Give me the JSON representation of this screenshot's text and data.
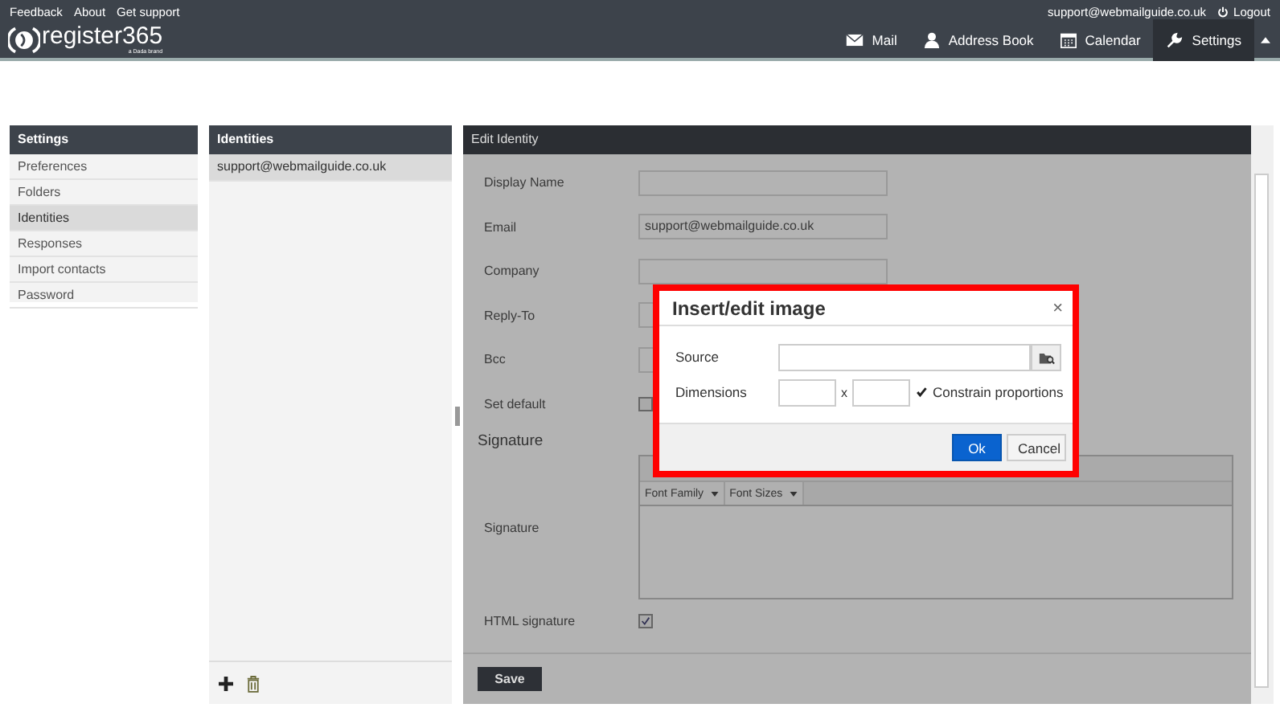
{
  "top_links": [
    "Feedback",
    "About",
    "Get support"
  ],
  "user": {
    "email": "support@webmailguide.co.uk",
    "logout": "Logout"
  },
  "brand": {
    "name": "register365",
    "tagline": "a Dada brand"
  },
  "nav": [
    {
      "label": "Mail",
      "selected": false
    },
    {
      "label": "Address Book",
      "selected": false
    },
    {
      "label": "Calendar",
      "selected": false
    },
    {
      "label": "Settings",
      "selected": true
    }
  ],
  "settings": {
    "title": "Settings",
    "items": [
      {
        "label": "Preferences",
        "selected": false
      },
      {
        "label": "Folders",
        "selected": false
      },
      {
        "label": "Identities",
        "selected": true
      },
      {
        "label": "Responses",
        "selected": false
      },
      {
        "label": "Import contacts",
        "selected": false
      },
      {
        "label": "Password",
        "selected": false
      }
    ]
  },
  "identities": {
    "title": "Identities",
    "items": [
      {
        "label": "support@webmailguide.co.uk",
        "selected": true
      }
    ]
  },
  "edit": {
    "title": "Edit Identity",
    "fields": [
      {
        "kind": "text",
        "label": "Display Name"
      },
      {
        "kind": "text",
        "label": "Email",
        "value": "support@webmailguide.co.uk"
      },
      {
        "kind": "text",
        "label": "Company"
      },
      {
        "kind": "text",
        "label": "Reply-To"
      },
      {
        "kind": "text",
        "label": "Bcc"
      },
      {
        "kind": "checkbox",
        "label": "Set default",
        "checked": false
      }
    ],
    "signature_heading": "Signature",
    "signature_label": "Signature",
    "editor_selects": [
      "Font Family",
      "Font Sizes"
    ],
    "html_signature": {
      "label": "HTML signature",
      "checked": true
    },
    "save": "Save"
  },
  "dialog": {
    "title": "Insert/edit image",
    "close": "×",
    "source_label": "Source",
    "dimensions_label": "Dimensions",
    "times": "x",
    "constrain": {
      "label": "Constrain proportions",
      "checked": true
    },
    "ok": "Ok",
    "cancel": "Cancel"
  }
}
